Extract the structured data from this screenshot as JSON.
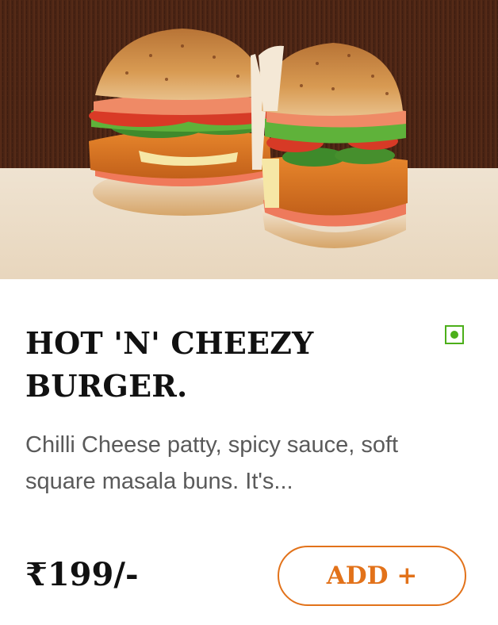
{
  "product": {
    "image_alt": "Hot 'n' Cheezy Burger photo",
    "veg_indicator": "veg",
    "title": "HOT 'N' CHEEZY BURGER.",
    "description": "Chilli Cheese patty, spicy sauce, soft square masala buns. It's...",
    "price": "₹199/-",
    "add_label": "ADD +"
  },
  "colors": {
    "accent": "#e2721a",
    "veg_green": "#4caf1a",
    "title": "#111111",
    "description": "#5a5a5a",
    "hero_background": "#4a2414",
    "table_surface": "#eee2d0"
  },
  "icons": {
    "veg_indicator": "veg-indicator-icon"
  }
}
